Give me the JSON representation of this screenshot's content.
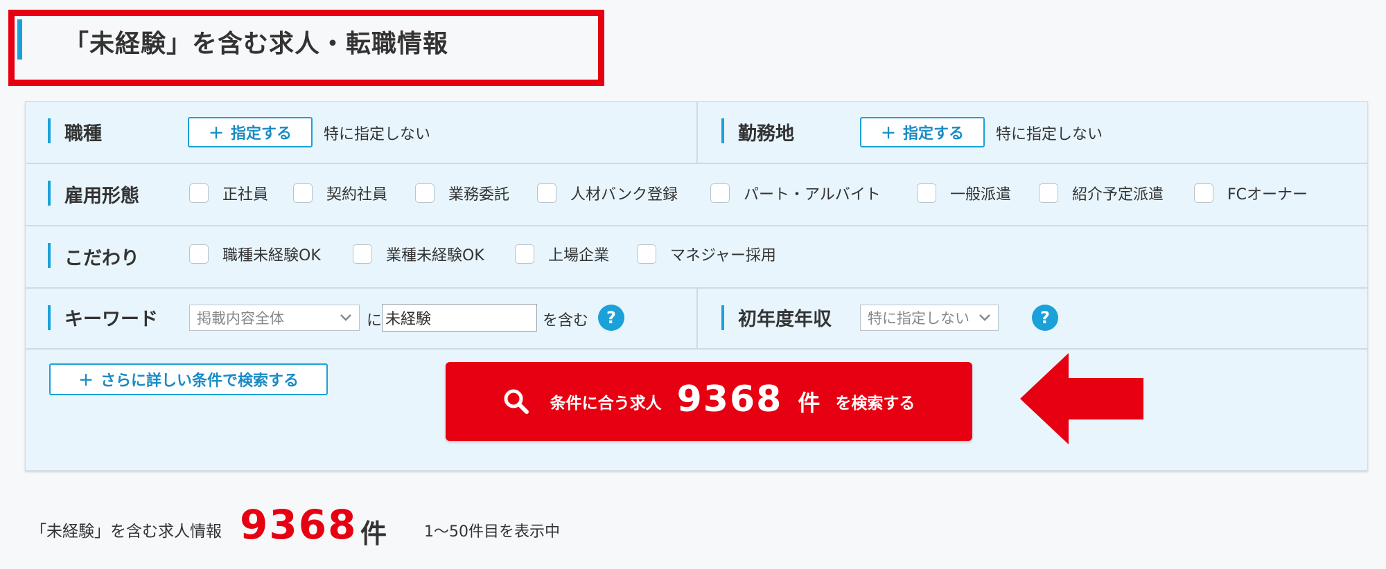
{
  "page_title": "「未経験」を含む求人・転職情報",
  "filters": {
    "job_type": {
      "label": "職種",
      "button": "指定する",
      "value": "特に指定しない"
    },
    "location": {
      "label": "勤務地",
      "button": "指定する",
      "value": "特に指定しない"
    },
    "employment": {
      "label": "雇用形態",
      "options": [
        "正社員",
        "契約社員",
        "業務委託",
        "人材バンク登録",
        "パート・アルバイト",
        "一般派遣",
        "紹介予定派遣",
        "FCオーナー"
      ]
    },
    "preferences": {
      "label": "こだわり",
      "options": [
        "職種未経験OK",
        "業種未経験OK",
        "上場企業",
        "マネジャー採用"
      ]
    },
    "keyword": {
      "label": "キーワード",
      "scope": "掲載内容全体",
      "joiner": "に",
      "value": "未経験",
      "suffix": "を含む"
    },
    "income": {
      "label": "初年度年収",
      "value": "特に指定しない"
    }
  },
  "buttons": {
    "more_conditions": "さらに詳しい条件で検索する",
    "search_prefix": "条件に合う求人",
    "search_count": "9368",
    "search_unit": "件",
    "search_suffix": "を検索する"
  },
  "results": {
    "label": "「未経験」を含む求人情報",
    "count": "9368",
    "unit": "件",
    "range": "1～50件目を表示中"
  },
  "colors": {
    "accent": "#1ba1d8",
    "highlight_red": "#e60012",
    "panel_bg": "#e8f5fc"
  },
  "icons": [
    "plus-icon",
    "search-icon",
    "help-icon",
    "chevron-down-icon",
    "arrow-left-icon"
  ]
}
